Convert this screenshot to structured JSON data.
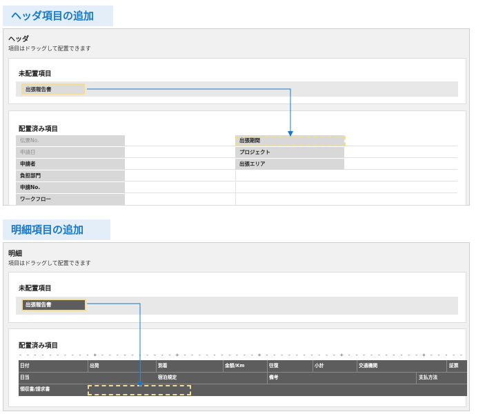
{
  "header_section": {
    "heading": "ヘッダ項目の追加",
    "panel_title": "ヘッダ",
    "panel_desc": "項目はドラッグして配置できます",
    "unplaced": {
      "title": "未配置項目",
      "chip": "出張報告書"
    },
    "placed": {
      "title": "配置済み項目",
      "rows": [
        {
          "left": "伝票No.",
          "right": "出張期間"
        },
        {
          "left": "申請日",
          "right": "プロジェクト"
        },
        {
          "left": "申請者",
          "right": "出張エリア"
        },
        {
          "left": "負担部門",
          "right": ""
        },
        {
          "left": "申請No.",
          "right": ""
        },
        {
          "left": "ワークフロー",
          "right": ""
        }
      ]
    }
  },
  "detail_section": {
    "heading": "明細項目の追加",
    "panel_title": "明細",
    "panel_desc": "項目はドラッグして配置できます",
    "unplaced": {
      "title": "未配置項目",
      "chip": "出張報告書"
    },
    "placed": {
      "title": "配置済み項目",
      "ruler": "- - - - - - - - - - + - - - - - - - - - - + - - - - - - - - - - + - - - - - - - - - - + - - - - - - - - - - + - - - - - - - - - - + - - - - - - - - - - + - - - - - - - - - - + - - - - - - - - - - + - - - - - - - - - - +",
      "row1": [
        "日付",
        "出発",
        "",
        "到着",
        "金額/Km",
        "往復",
        "小計",
        "交通機関",
        "証票"
      ],
      "row2": [
        "日当",
        "宿泊規定",
        "備考",
        "支払方法"
      ],
      "row3": [
        "領収書/請求書"
      ]
    }
  },
  "colors": {
    "accent": "#1878c8",
    "dropzone": "#f1dd95",
    "grid": "#5d5d5d"
  }
}
